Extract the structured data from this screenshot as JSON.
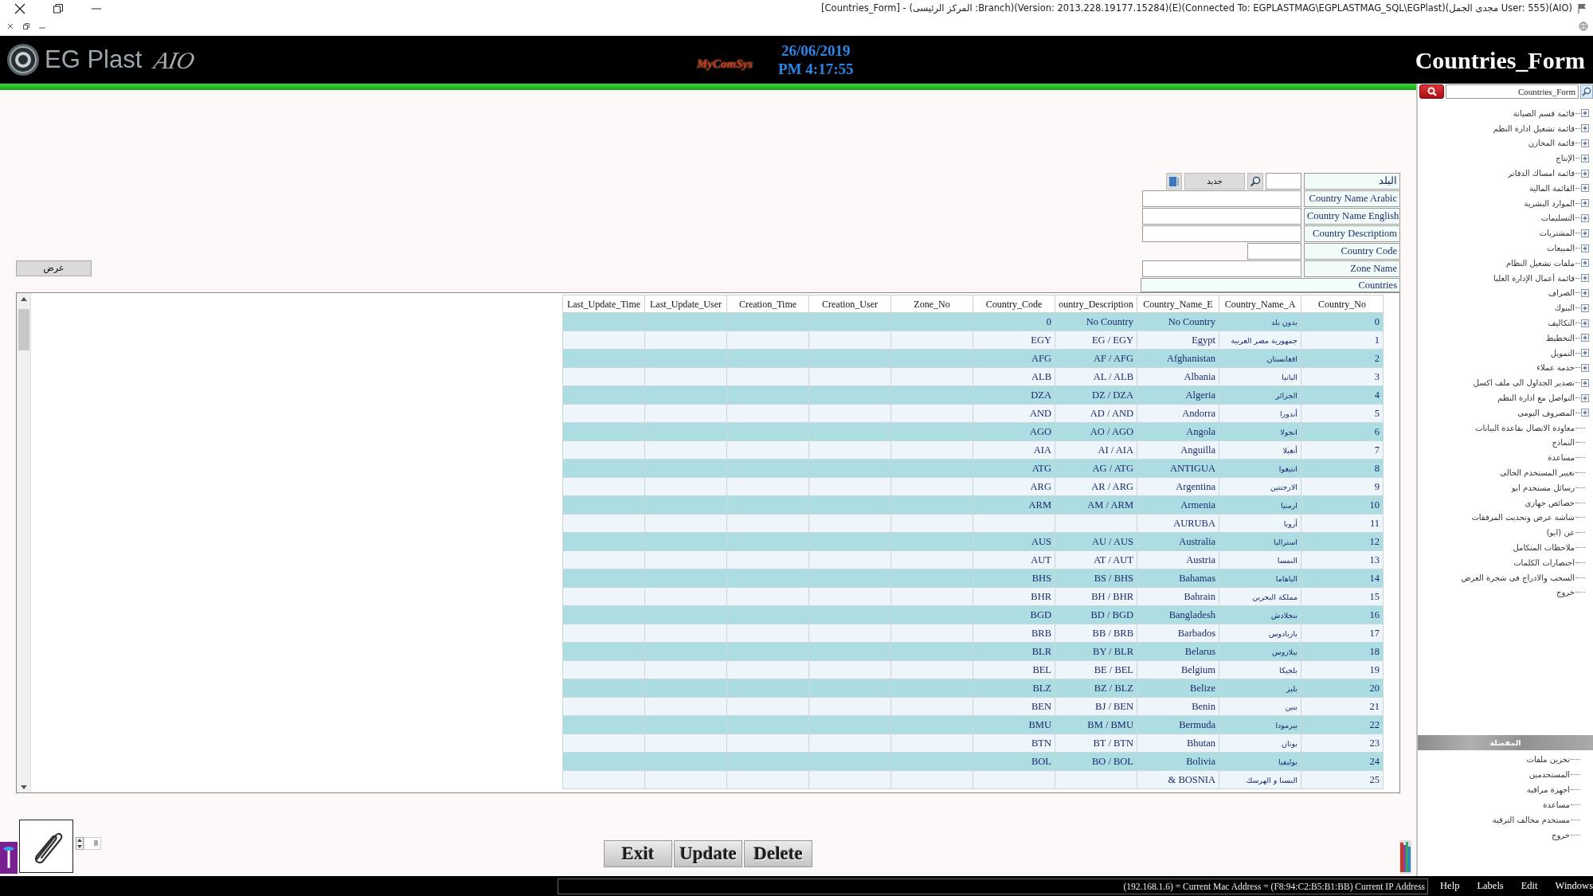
{
  "title_bar": {
    "title": "[Countries_Form] - (المركز الرئيسى :Branch)(Version: 2013.228.19177.15284)(E)(Connected To: EGPLASTMAG\\EGPLASTMAG_SQL\\EGPlast)(مجدى الجمل User: 555)(AIO)"
  },
  "header": {
    "app_name": "EG Plast",
    "app_badge": "AIO",
    "vendor": "MyComSys",
    "date": "26/06/2019",
    "time": "PM 4:17:55",
    "form_title": "Countries_Form"
  },
  "form": {
    "country_label": "البلد",
    "new_button": "جديد",
    "fields": [
      {
        "label": "Country Name Arabic",
        "kind": "long"
      },
      {
        "label": "Country Name English",
        "kind": "long"
      },
      {
        "label": "Country Descriptiom",
        "kind": "long"
      },
      {
        "label": "Country Code",
        "kind": "short"
      },
      {
        "label": "Zone Name",
        "kind": "long"
      }
    ],
    "show_button": "عرض",
    "grid_title": "Countries"
  },
  "table": {
    "columns": [
      "Country_No",
      "Country_Name_A",
      "Country_Name_E",
      "ountry_Description",
      "Country_Code",
      "Zone_No",
      "Creation_User",
      "Creation_Time",
      "Last_Update_User",
      "Last_Update_Time"
    ],
    "rows": [
      {
        "country_no": "0",
        "country_name_a": "بدون بلد",
        "country_name_e": "No Country",
        "country_description": "No Country",
        "country_code": "0"
      },
      {
        "country_no": "1",
        "country_name_a": "جمهورية مصر العربية",
        "country_name_e": "Egypt",
        "country_description": "EG / EGY",
        "country_code": "EGY"
      },
      {
        "country_no": "2",
        "country_name_a": "افغانستان",
        "country_name_e": "Afghanistan",
        "country_description": "AF / AFG",
        "country_code": "AFG"
      },
      {
        "country_no": "3",
        "country_name_a": "البانيا",
        "country_name_e": "Albania",
        "country_description": "AL / ALB",
        "country_code": "ALB"
      },
      {
        "country_no": "4",
        "country_name_a": "الجزائر",
        "country_name_e": "Algeria",
        "country_description": "DZ / DZA",
        "country_code": "DZA"
      },
      {
        "country_no": "5",
        "country_name_a": "أندورا",
        "country_name_e": "Andorra",
        "country_description": "AD / AND",
        "country_code": "AND"
      },
      {
        "country_no": "6",
        "country_name_a": "انجولا",
        "country_name_e": "Angola",
        "country_description": "AO / AGO",
        "country_code": "AGO"
      },
      {
        "country_no": "7",
        "country_name_a": "أنغيلا",
        "country_name_e": "Anguilla",
        "country_description": "AI / AIA",
        "country_code": "AIA"
      },
      {
        "country_no": "8",
        "country_name_a": "انتيغوا",
        "country_name_e": "ANTIGUA",
        "country_description": "AG / ATG",
        "country_code": "ATG"
      },
      {
        "country_no": "9",
        "country_name_a": "الارجنتين",
        "country_name_e": "Argentina",
        "country_description": "AR / ARG",
        "country_code": "ARG"
      },
      {
        "country_no": "10",
        "country_name_a": "ارمنيا",
        "country_name_e": "Armenia",
        "country_description": "AM / ARM",
        "country_code": "ARM"
      },
      {
        "country_no": "11",
        "country_name_a": "أروبا",
        "country_name_e": "AURUBA"
      },
      {
        "country_no": "12",
        "country_name_a": "استراليا",
        "country_name_e": "Australia",
        "country_description": "AU / AUS",
        "country_code": "AUS"
      },
      {
        "country_no": "13",
        "country_name_a": "النمسا",
        "country_name_e": "Austria",
        "country_description": "AT / AUT",
        "country_code": "AUT"
      },
      {
        "country_no": "14",
        "country_name_a": "الباهاما",
        "country_name_e": "Bahamas",
        "country_description": "BS / BHS",
        "country_code": "BHS"
      },
      {
        "country_no": "15",
        "country_name_a": "مملكة البحرين",
        "country_name_e": "Bahrain",
        "country_description": "BH / BHR",
        "country_code": "BHR"
      },
      {
        "country_no": "16",
        "country_name_a": "بنجلادش",
        "country_name_e": "Bangladesh",
        "country_description": "BD / BGD",
        "country_code": "BGD"
      },
      {
        "country_no": "17",
        "country_name_a": "باربادوس",
        "country_name_e": "Barbados",
        "country_description": "BB / BRB",
        "country_code": "BRB"
      },
      {
        "country_no": "18",
        "country_name_a": "بيلاروس",
        "country_name_e": "Belarus",
        "country_description": "BY / BLR",
        "country_code": "BLR"
      },
      {
        "country_no": "19",
        "country_name_a": "بلجيكا",
        "country_name_e": "Belgium",
        "country_description": "BE / BEL",
        "country_code": "BEL"
      },
      {
        "country_no": "20",
        "country_name_a": "بليز",
        "country_name_e": "Belize",
        "country_description": "BZ / BLZ",
        "country_code": "BLZ"
      },
      {
        "country_no": "21",
        "country_name_a": "بنين",
        "country_name_e": "Benin",
        "country_description": "BJ / BEN",
        "country_code": "BEN"
      },
      {
        "country_no": "22",
        "country_name_a": "بيرمودا",
        "country_name_e": "Bermuda",
        "country_description": "BM / BMU",
        "country_code": "BMU"
      },
      {
        "country_no": "23",
        "country_name_a": "بوتان",
        "country_name_e": "Bhutan",
        "country_description": "BT / BTN",
        "country_code": "BTN"
      },
      {
        "country_no": "24",
        "country_name_a": "بوليفيا",
        "country_name_e": "Bolivia",
        "country_description": "BO / BOL",
        "country_code": "BOL"
      },
      {
        "country_no": "25",
        "country_name_a": "البسنا و الهرسك",
        "country_name_e": "& BOSNIA"
      }
    ]
  },
  "bottom": {
    "spinner_value": "8",
    "buttons": [
      "Delete",
      "Update",
      "Exit"
    ]
  },
  "sidebar": {
    "search_value": "Countries_Form",
    "menu": [
      {
        "label": "قائمة قسم الصيانة",
        "expandable": true
      },
      {
        "label": "قائمة تشغيل ادارة النظم",
        "expandable": true
      },
      {
        "label": "قائمة المخازن",
        "expandable": true
      },
      {
        "label": "الإنتاج",
        "expandable": true
      },
      {
        "label": "قائمة امساك الدفاتر",
        "expandable": true
      },
      {
        "label": "القائمة المالية",
        "expandable": true
      },
      {
        "label": "الموارد البشرية",
        "expandable": true
      },
      {
        "label": "التسليمات",
        "expandable": true
      },
      {
        "label": "المشتريات",
        "expandable": true
      },
      {
        "label": "المبيعات",
        "expandable": true
      },
      {
        "label": "ملفات تشغيل النظام",
        "expandable": true
      },
      {
        "label": "قائمة أعمال الإدارة العليا",
        "expandable": true
      },
      {
        "label": "الصراف",
        "expandable": true
      },
      {
        "label": "البنوك",
        "expandable": true
      },
      {
        "label": "التكاليف",
        "expandable": true
      },
      {
        "label": "التخطيط",
        "expandable": true
      },
      {
        "label": "التمويل",
        "expandable": true
      },
      {
        "label": "خدمة عملاء",
        "expandable": true
      },
      {
        "label": "تصدير الجداول الى ملف اكسل",
        "expandable": true
      },
      {
        "label": "التواصل مع ادارة النظم",
        "expandable": true
      },
      {
        "label": "المصروف اليومى",
        "expandable": true
      },
      {
        "label": "معاودة الاتصال بقاعدة البيانات",
        "expandable": false
      },
      {
        "label": "النماذج",
        "expandable": false
      },
      {
        "label": "مساعدة",
        "expandable": false
      },
      {
        "label": "تغيير المستخدم الحالى",
        "expandable": false
      },
      {
        "label": "رسائل مستخدم ايو",
        "expandable": false
      },
      {
        "label": "خصائص جهازى",
        "expandable": false
      },
      {
        "label": "شاشة عرض وتحديث المرفقات",
        "expandable": false
      },
      {
        "label": "عن (ايو)",
        "expandable": false
      },
      {
        "label": "ملاحظات المتكامل",
        "expandable": false
      },
      {
        "label": "اختصارات الكلمات",
        "expandable": false
      },
      {
        "label": "السحب والادراج فى شجرة العرض",
        "expandable": false
      },
      {
        "label": "خروج",
        "expandable": false
      }
    ],
    "favorites": {
      "title": "المفضلة",
      "items": [
        "تخزين ملفات",
        "المستخدمين",
        "اجهزة مراقبة",
        "مساعدة",
        "مستخدم مخالف الترقية",
        "خروج"
      ]
    }
  },
  "status_bar": {
    "address_text": "(192.168.1.6) = Current Mac Address = (F8:94:C2:B5:B1:BB) Current IP Address",
    "menus": [
      "Windows",
      "Edit",
      "Labels",
      "Help"
    ]
  }
}
